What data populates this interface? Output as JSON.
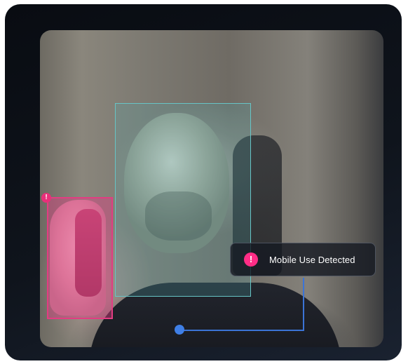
{
  "camera_feed": {
    "face_detection": {
      "label": ""
    },
    "phone_detection": {
      "indicator_icon": "exclamation-icon"
    },
    "alert": {
      "icon": "exclamation-icon",
      "message": "Mobile Use Detected"
    }
  },
  "colors": {
    "face_box": "#67c4c6",
    "phone_box": "#e23d82",
    "connector": "#3b74d6",
    "alert_icon": "#ff2d86"
  }
}
